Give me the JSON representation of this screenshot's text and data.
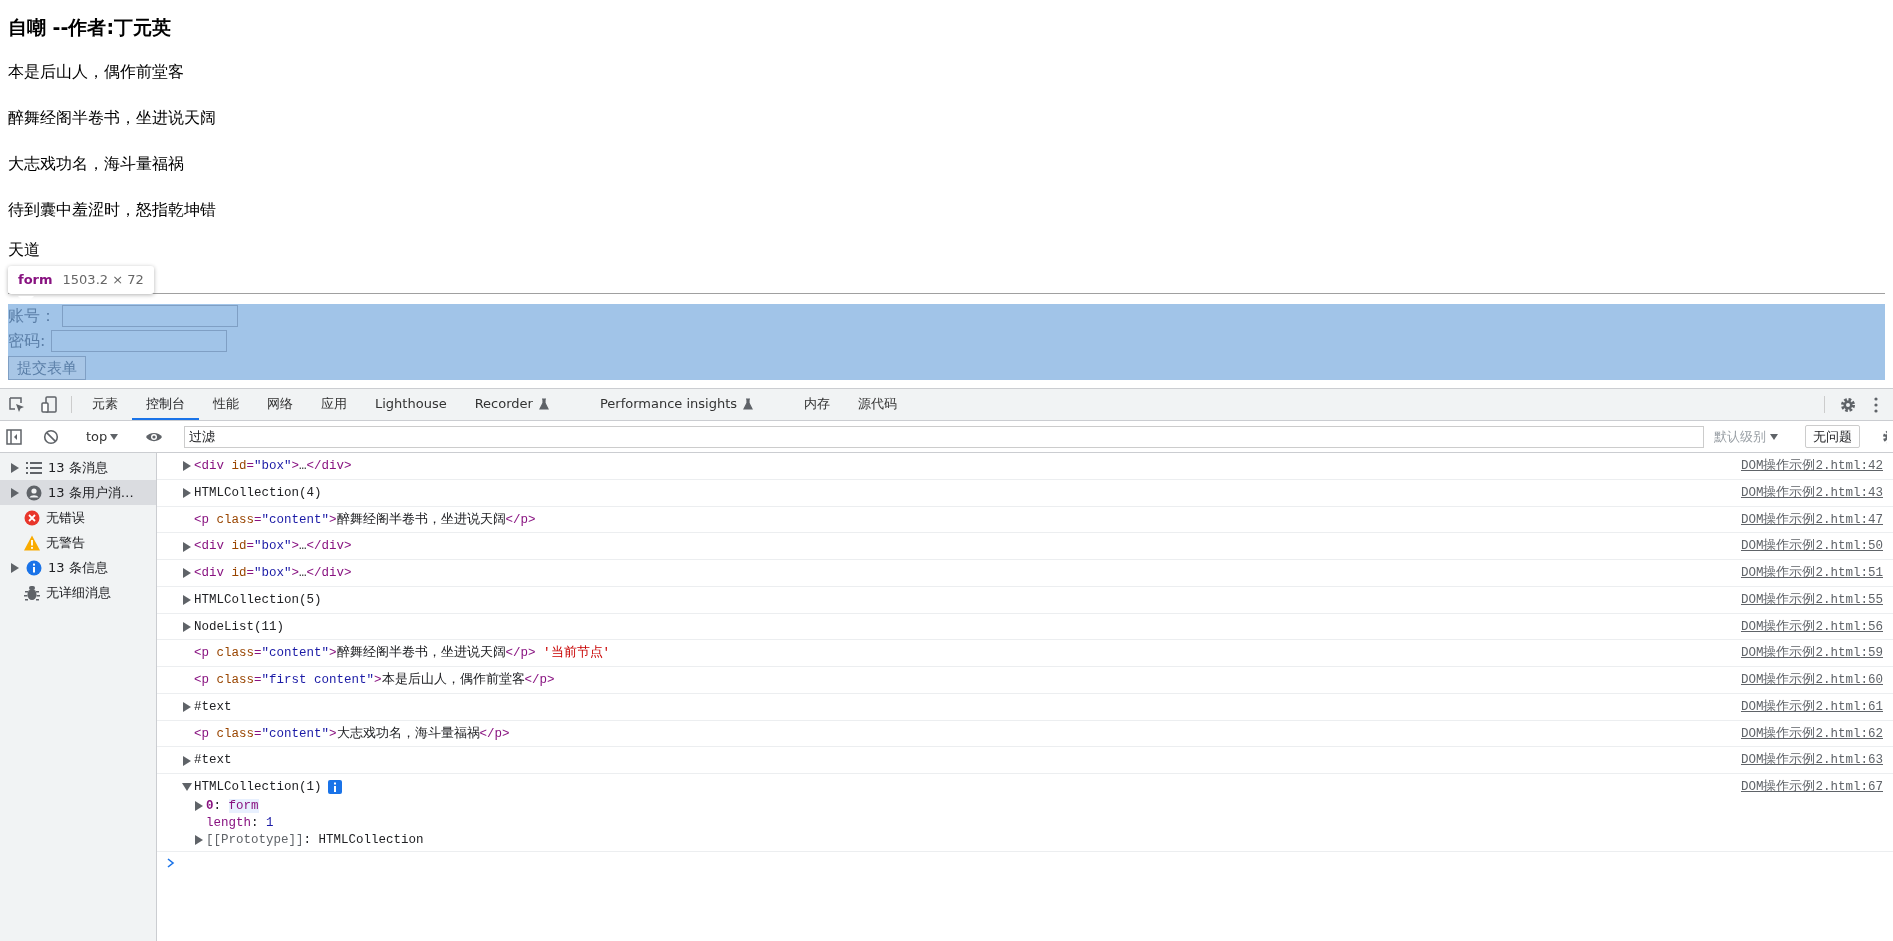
{
  "page": {
    "heading": "自嘲 --作者:丁元英",
    "lines": [
      "本是后山人，偶作前堂客",
      "醉舞经阁半卷书，坐进说天阔",
      "大志戏功名，海斗量福祸",
      "待到囊中羞涩时，怒指乾坤错",
      "天道"
    ],
    "form": {
      "fields": [
        {
          "label": "账号："
        },
        {
          "label": "密码:"
        }
      ],
      "submit": "提交表单"
    },
    "inspect_tooltip": {
      "tag": "form",
      "size": "1503.2 × 72"
    }
  },
  "devtools": {
    "tabs": [
      {
        "label": "元素",
        "selected": false,
        "experimental": false
      },
      {
        "label": "控制台",
        "selected": true,
        "experimental": false
      },
      {
        "label": "性能",
        "selected": false,
        "experimental": false
      },
      {
        "label": "网络",
        "selected": false,
        "experimental": false
      },
      {
        "label": "应用",
        "selected": false,
        "experimental": false
      },
      {
        "label": "Lighthouse",
        "selected": false,
        "experimental": false
      },
      {
        "label": "Recorder",
        "selected": false,
        "experimental": true
      },
      {
        "label": "Performance insights",
        "selected": false,
        "experimental": true
      },
      {
        "label": "内存",
        "selected": false,
        "experimental": false
      },
      {
        "label": "源代码",
        "selected": false,
        "experimental": false
      }
    ],
    "toolbar": {
      "context": "top",
      "filter_placeholder": "过滤",
      "level": {
        "label": "默认级别",
        "disabled": true
      },
      "issues": "无问题"
    },
    "sidebar": [
      {
        "kind": "messages",
        "label": "13 条消息",
        "expandable": true,
        "selected": false
      },
      {
        "kind": "user",
        "label": "13 条用户消…",
        "expandable": true,
        "selected": true
      },
      {
        "kind": "errors",
        "label": "无错误",
        "expandable": false,
        "selected": false
      },
      {
        "kind": "warnings",
        "label": "无警告",
        "expandable": false,
        "selected": false
      },
      {
        "kind": "info",
        "label": "13 条信息",
        "expandable": true,
        "selected": false
      },
      {
        "kind": "verbose",
        "label": "无详细消息",
        "expandable": false,
        "selected": false
      }
    ],
    "messages": [
      {
        "expandable": true,
        "expanded": false,
        "info_badge": false,
        "parts": [
          {
            "kind": "tag",
            "t": "<div"
          },
          {
            "kind": "attr",
            "t": " id"
          },
          {
            "kind": "tag",
            "t": "="
          },
          {
            "kind": "value",
            "t": "\"box\""
          },
          {
            "kind": "tag",
            "t": ">"
          },
          {
            "kind": "text",
            "t": "…"
          },
          {
            "kind": "tag",
            "t": "</div>"
          }
        ],
        "source": "DOM操作示例2.html:42"
      },
      {
        "expandable": true,
        "expanded": false,
        "info_badge": false,
        "parts": [
          {
            "kind": "text",
            "t": "HTMLCollection(4)"
          }
        ],
        "source": "DOM操作示例2.html:43"
      },
      {
        "expandable": false,
        "info_badge": false,
        "parts": [
          {
            "kind": "tag",
            "t": "<p"
          },
          {
            "kind": "attr",
            "t": " class"
          },
          {
            "kind": "tag",
            "t": "="
          },
          {
            "kind": "value",
            "t": "\"content\""
          },
          {
            "kind": "tag",
            "t": ">"
          },
          {
            "kind": "text",
            "t": "醉舞经阁半卷书，坐进说天阔"
          },
          {
            "kind": "tag",
            "t": "</p>"
          }
        ],
        "source": "DOM操作示例2.html:47"
      },
      {
        "expandable": true,
        "expanded": false,
        "info_badge": false,
        "parts": [
          {
            "kind": "tag",
            "t": "<div"
          },
          {
            "kind": "attr",
            "t": " id"
          },
          {
            "kind": "tag",
            "t": "="
          },
          {
            "kind": "value",
            "t": "\"box\""
          },
          {
            "kind": "tag",
            "t": ">"
          },
          {
            "kind": "text",
            "t": "…"
          },
          {
            "kind": "tag",
            "t": "</div>"
          }
        ],
        "source": "DOM操作示例2.html:50"
      },
      {
        "expandable": true,
        "expanded": false,
        "info_badge": false,
        "parts": [
          {
            "kind": "tag",
            "t": "<div"
          },
          {
            "kind": "attr",
            "t": " id"
          },
          {
            "kind": "tag",
            "t": "="
          },
          {
            "kind": "value",
            "t": "\"box\""
          },
          {
            "kind": "tag",
            "t": ">"
          },
          {
            "kind": "text",
            "t": "…"
          },
          {
            "kind": "tag",
            "t": "</div>"
          }
        ],
        "source": "DOM操作示例2.html:51"
      },
      {
        "expandable": true,
        "expanded": false,
        "info_badge": false,
        "parts": [
          {
            "kind": "text",
            "t": "HTMLCollection(5)"
          }
        ],
        "source": "DOM操作示例2.html:55"
      },
      {
        "expandable": true,
        "expanded": false,
        "info_badge": false,
        "parts": [
          {
            "kind": "text",
            "t": "NodeList(11)"
          }
        ],
        "source": "DOM操作示例2.html:56"
      },
      {
        "expandable": false,
        "info_badge": false,
        "parts": [
          {
            "kind": "tag",
            "t": "<p"
          },
          {
            "kind": "attr",
            "t": " class"
          },
          {
            "kind": "tag",
            "t": "="
          },
          {
            "kind": "value",
            "t": "\"content\""
          },
          {
            "kind": "tag",
            "t": ">"
          },
          {
            "kind": "text",
            "t": "醉舞经阁半卷书，坐进说天阔"
          },
          {
            "kind": "tag",
            "t": "</p>"
          },
          {
            "kind": "string",
            "t": " '当前节点'"
          }
        ],
        "source": "DOM操作示例2.html:59"
      },
      {
        "expandable": false,
        "info_badge": false,
        "parts": [
          {
            "kind": "tag",
            "t": "<p"
          },
          {
            "kind": "attr",
            "t": " class"
          },
          {
            "kind": "tag",
            "t": "="
          },
          {
            "kind": "value",
            "t": "\"first content\""
          },
          {
            "kind": "tag",
            "t": ">"
          },
          {
            "kind": "text",
            "t": "本是后山人，偶作前堂客"
          },
          {
            "kind": "tag",
            "t": "</p>"
          }
        ],
        "source": "DOM操作示例2.html:60"
      },
      {
        "expandable": true,
        "expanded": false,
        "info_badge": false,
        "parts": [
          {
            "kind": "text",
            "t": "#text"
          }
        ],
        "source": "DOM操作示例2.html:61"
      },
      {
        "expandable": false,
        "info_badge": false,
        "parts": [
          {
            "kind": "tag",
            "t": "<p"
          },
          {
            "kind": "attr",
            "t": " class"
          },
          {
            "kind": "tag",
            "t": "="
          },
          {
            "kind": "value",
            "t": "\"content\""
          },
          {
            "kind": "tag",
            "t": ">"
          },
          {
            "kind": "text",
            "t": "大志戏功名，海斗量福祸"
          },
          {
            "kind": "tag",
            "t": "</p>"
          }
        ],
        "source": "DOM操作示例2.html:62"
      },
      {
        "expandable": true,
        "expanded": false,
        "info_badge": false,
        "parts": [
          {
            "kind": "text",
            "t": "#text"
          }
        ],
        "source": "DOM操作示例2.html:63"
      },
      {
        "expandable": true,
        "expanded": true,
        "info_badge": true,
        "parts": [
          {
            "kind": "text",
            "t": "HTMLCollection(1)"
          }
        ],
        "source": "DOM操作示例2.html:67",
        "children": [
          {
            "expandable": true,
            "expanded": false,
            "parts": [
              {
                "kind": "key",
                "t": "0"
              },
              {
                "kind": "text",
                "t": ": "
              },
              {
                "kind": "node",
                "t": "form"
              }
            ]
          },
          {
            "expandable": false,
            "parts": [
              {
                "kind": "prop",
                "t": "length"
              },
              {
                "kind": "text",
                "t": ": "
              },
              {
                "kind": "value",
                "t": "1"
              }
            ]
          },
          {
            "expandable": true,
            "expanded": false,
            "parts": [
              {
                "kind": "proto",
                "t": "[[Prototype]]"
              },
              {
                "kind": "text",
                "t": ": HTMLCollection"
              }
            ]
          }
        ]
      }
    ]
  }
}
